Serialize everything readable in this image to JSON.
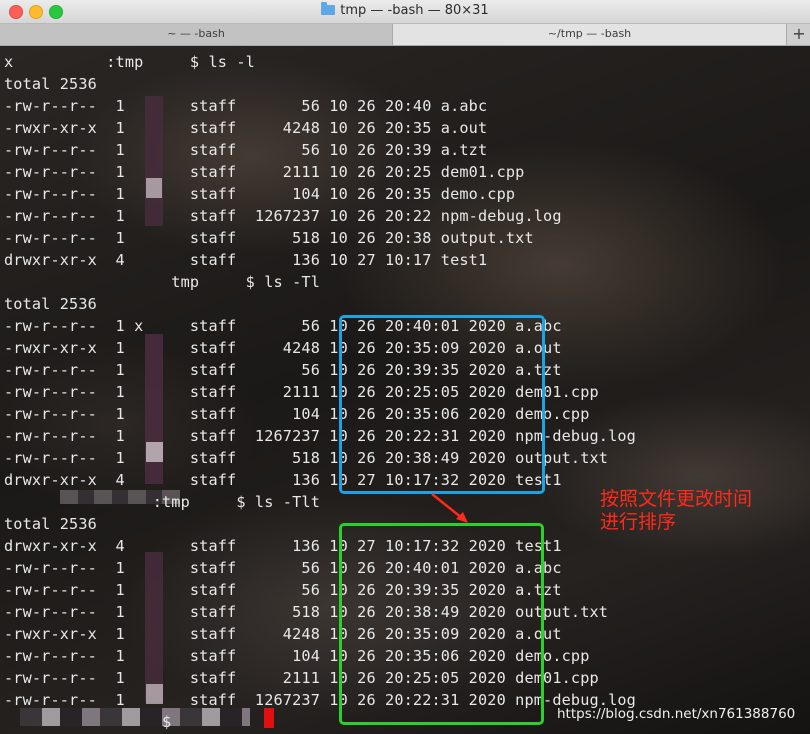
{
  "window": {
    "title": "tmp — -bash — 80×31"
  },
  "tabs": [
    {
      "label": "~ — -bash"
    },
    {
      "label": "~/tmp — -bash"
    }
  ],
  "add_tab_label": "+",
  "terminal": {
    "lines": [
      "x          :tmp     $ ls -l",
      "total 2536",
      "-rw-r--r--  1       staff       56 10 26 20:40 a.abc",
      "-rwxr-xr-x  1       staff     4248 10 26 20:35 a.out",
      "-rw-r--r--  1       staff       56 10 26 20:39 a.tzt",
      "-rw-r--r--  1       staff     2111 10 26 20:25 dem01.cpp",
      "-rw-r--r--  1       staff      104 10 26 20:35 demo.cpp",
      "-rw-r--r--  1       staff  1267237 10 26 20:22 npm-debug.log",
      "-rw-r--r--  1       staff      518 10 26 20:38 output.txt",
      "drwxr-xr-x  4       staff      136 10 27 10:17 test1",
      "                  tmp     $ ls -Tl",
      "total 2536",
      "-rw-r--r--  1 x     staff       56 10 26 20:40:01 2020 a.abc",
      "-rwxr-xr-x  1       staff     4248 10 26 20:35:09 2020 a.out",
      "-rw-r--r--  1       staff       56 10 26 20:39:35 2020 a.tzt",
      "-rw-r--r--  1       staff     2111 10 26 20:25:05 2020 dem01.cpp",
      "-rw-r--r--  1       staff      104 10 26 20:35:06 2020 demo.cpp",
      "-rw-r--r--  1       staff  1267237 10 26 20:22:31 2020 npm-debug.log",
      "-rw-r--r--  1       staff      518 10 26 20:38:49 2020 output.txt",
      "drwxr-xr-x  4       staff      136 10 27 10:17:32 2020 test1",
      "                :tmp     $ ls -Tlt",
      "total 2536",
      "drwxr-xr-x  4       staff      136 10 27 10:17:32 2020 test1",
      "-rw-r--r--  1       staff       56 10 26 20:40:01 2020 a.abc",
      "-rw-r--r--  1       staff       56 10 26 20:39:35 2020 a.tzt",
      "-rw-r--r--  1       staff      518 10 26 20:38:49 2020 output.txt",
      "-rwxr-xr-x  1       staff     4248 10 26 20:35:09 2020 a.out",
      "-rw-r--r--  1       staff      104 10 26 20:35:06 2020 demo.cpp",
      "-rw-r--r--  1       staff     2111 10 26 20:25:05 2020 dem01.cpp",
      "-rw-r--r--  1       staff  1267237 10 26 20:22:31 2020 npm-debug.log",
      "                 $ "
    ]
  },
  "annotation": {
    "line1": "按照文件更改时间",
    "line2": "进行排序",
    "color": "#ff2a1a"
  },
  "highlight_colors": {
    "blue": "#1ea2e6",
    "green": "#2bd12b"
  },
  "watermark": "https://blog.csdn.net/xn761388760"
}
